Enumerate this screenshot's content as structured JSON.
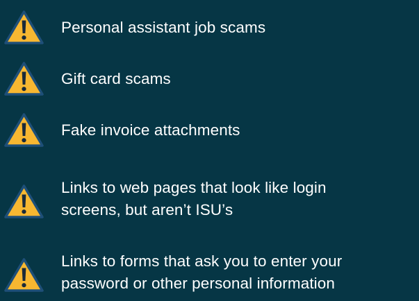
{
  "colors": {
    "background": "#063645",
    "icon_fill": "#f7b731",
    "icon_outline": "#1e4f78",
    "icon_glyph": "#1a2a3a",
    "text": "#ffffff"
  },
  "items": [
    {
      "icon": "warning-icon",
      "label": "Personal assistant job scams"
    },
    {
      "icon": "warning-icon",
      "label": "Gift card scams"
    },
    {
      "icon": "warning-icon",
      "label": "Fake invoice attachments"
    },
    {
      "icon": "warning-icon",
      "label_line1": "Links to web pages that look like login",
      "label_line2": "screens, but aren’t ISU’s"
    },
    {
      "icon": "warning-icon",
      "label_line1": "Links to forms that ask you to enter your",
      "label_line2": "password or other personal information"
    }
  ]
}
